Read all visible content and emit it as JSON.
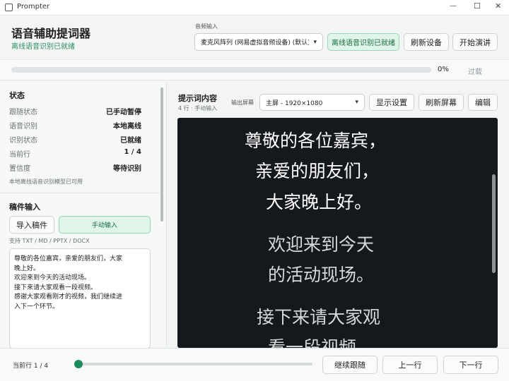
{
  "window": {
    "title": "Prompter",
    "controls": [
      "—",
      "☐",
      "✕"
    ]
  },
  "header": {
    "title": "语音辅助提词器",
    "subtitle": "离线语音识别已就绪",
    "audio_input_label": "音频输入",
    "audio_device": "麦克风阵列 (网易虚拟音频设备) (默认)",
    "recognition_badge": "离线语音识别已就绪",
    "refresh_devices": "刷新设备",
    "start_speech": "开始演讲"
  },
  "progress": {
    "value": 0,
    "label": "0%",
    "skip_label": "过载"
  },
  "status": {
    "section_title": "状态",
    "rows": [
      {
        "label": "跟随状态",
        "value": "已手动暂停"
      },
      {
        "label": "语音识别",
        "value": "本地离线"
      },
      {
        "label": "识别状态",
        "value": "已就绪"
      },
      {
        "label": "当前行",
        "value": "1 / 4"
      },
      {
        "label": "置信度",
        "value": "等待识别"
      }
    ],
    "note": "本地离线语音识别模型已可用"
  },
  "script_input": {
    "section_title": "稿件输入",
    "import_button": "导入稿件",
    "manual_button": "手动输入",
    "formats": "支持 TXT / MD / PPTX / DOCX",
    "text_lines": [
      "尊敬的各位嘉宾，亲爱的朋友们，大家",
      "晚上好。",
      "欢迎来到今天的活动现场。",
      "接下来请大家观看一段视频。",
      "感谢大家观看刚才的视频，我们继续进",
      "入下一个环节。"
    ]
  },
  "prompt": {
    "title": "提示词内容",
    "meta": "4 行 · 手动输入",
    "output_screen_label": "输出屏幕",
    "output_screen": "主屏 - 1920×1080",
    "display_settings": "显示设置",
    "refresh_screen": "刷新屏幕",
    "edit": "编辑",
    "lines": [
      "尊敬的各位嘉宾，",
      "亲爱的朋友们，",
      "大家晚上好。",
      "欢迎来到今天",
      "的活动现场。",
      "接下来请大家观",
      "看一段视频"
    ],
    "colors": {
      "background": "#15191d",
      "current": "#ffffff",
      "upcoming": "#d6d8da"
    }
  },
  "footer": {
    "current_line": "当前行 1 / 4",
    "slider_value": 0,
    "resume_follow": "继续跟随",
    "prev_line": "上一行",
    "next_line": "下一行"
  },
  "colors": {
    "accent": "#1c8a5a",
    "badge_bg": "#def5e8",
    "panel_bg": "#f7f8f8"
  }
}
